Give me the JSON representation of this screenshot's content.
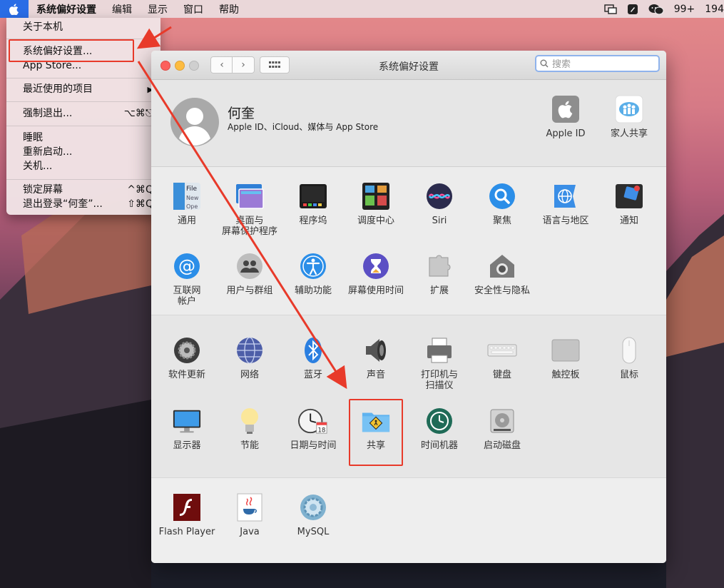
{
  "menubar": {
    "app_name": "系统偏好设置",
    "items": [
      "编辑",
      "显示",
      "窗口",
      "帮助"
    ],
    "badge_count": "99+",
    "time_partial": "194"
  },
  "apple_menu": {
    "about": "关于本机",
    "system_prefs": "系统偏好设置...",
    "app_store": "App Store...",
    "recent_items": "最近使用的项目",
    "force_quit": "强制退出...",
    "force_quit_shortcut": "⌥⌘⎋",
    "sleep": "睡眠",
    "restart": "重新启动...",
    "shutdown": "关机...",
    "lock_screen": "锁定屏幕",
    "lock_screen_shortcut": "^⌘Q",
    "logout": "退出登录“何奎”...",
    "logout_shortcut": "⇧⌘Q"
  },
  "window": {
    "title": "系统偏好设置",
    "search_placeholder": "搜索",
    "user_name": "何奎",
    "user_subtitle": "Apple ID、iCloud、媒体与 App Store",
    "apple_id_label": "Apple ID",
    "family_label": "家人共享"
  },
  "panes": {
    "general": "通用",
    "desktop": [
      "桌面与",
      "屏幕保护程序"
    ],
    "dock": "程序坞",
    "mission_control": "调度中心",
    "siri": "Siri",
    "spotlight": "聚焦",
    "language": "语言与地区",
    "notifications": "通知",
    "internet_accounts": [
      "互联网",
      "帐户"
    ],
    "users_groups": "用户与群组",
    "accessibility": "辅助功能",
    "screen_time": "屏幕使用时间",
    "extensions": "扩展",
    "security": "安全性与隐私",
    "software_update": "软件更新",
    "network": "网络",
    "bluetooth": "蓝牙",
    "sound": "声音",
    "printers": [
      "打印机与",
      "扫描仪"
    ],
    "keyboard": "键盘",
    "trackpad": "触控板",
    "mouse": "鼠标",
    "displays": "显示器",
    "energy": "节能",
    "date_time": "日期与时间",
    "sharing": "共享",
    "time_machine": "时间机器",
    "startup_disk": "启动磁盘",
    "flash": "Flash Player",
    "java": "Java",
    "mysql": "MySQL"
  },
  "colors": {
    "highlight_red": "#e83a2a",
    "menubar_apple_blue": "#2a6de6"
  }
}
